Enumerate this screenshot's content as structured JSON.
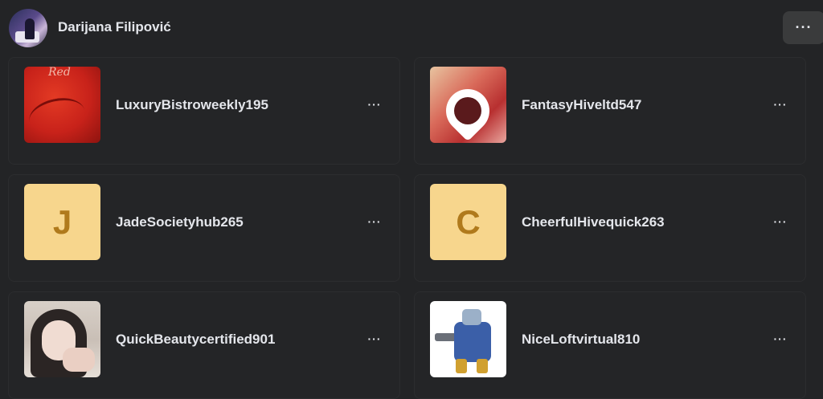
{
  "owner": {
    "name": "Darijana Filipović"
  },
  "header": {
    "more_label": "···"
  },
  "cards": [
    {
      "title": "LuxuryBistroweekly195",
      "thumb": "red-artwork-image",
      "more_label": "···",
      "thumb_text": "Red"
    },
    {
      "title": "FantasyHiveltd547",
      "thumb": "heart-frame-image",
      "more_label": "···"
    },
    {
      "title": "JadeSocietyhub265",
      "thumb": "letter",
      "letter": "J",
      "more_label": "···"
    },
    {
      "title": "CheerfulHivequick263",
      "thumb": "letter",
      "letter": "C",
      "more_label": "···"
    },
    {
      "title": "QuickBeautycertified901",
      "thumb": "girl-photo-image",
      "more_label": "···"
    },
    {
      "title": "NiceLoftvirtual810",
      "thumb": "robot-figure-image",
      "more_label": "···"
    }
  ],
  "colors": {
    "background": "#232426",
    "letter_bg": "#f7d68d",
    "letter_fg": "#b07a1c"
  }
}
